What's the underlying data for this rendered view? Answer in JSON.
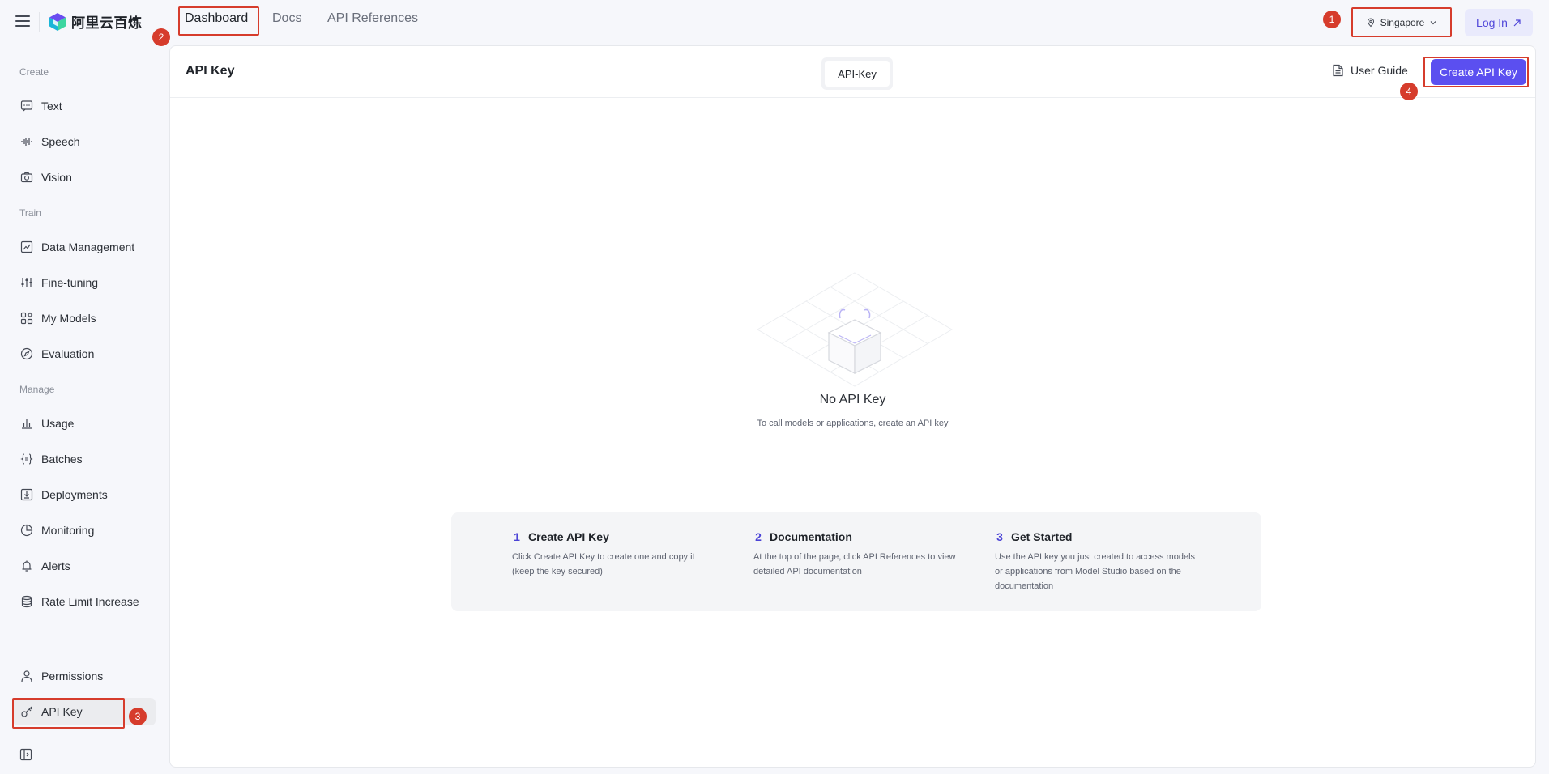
{
  "header": {
    "logo_text": "阿里云百炼",
    "tabs": [
      {
        "label": "Dashboard"
      },
      {
        "label": "Docs"
      },
      {
        "label": "API References"
      }
    ],
    "region": "Singapore",
    "login_label": "Log In"
  },
  "annotations": {
    "badge_1": "1",
    "badge_2": "2",
    "badge_3": "3",
    "badge_4": "4"
  },
  "sidebar": {
    "sections": {
      "create": "Create",
      "train": "Train",
      "manage": "Manage"
    },
    "items": [
      {
        "label": "Text",
        "icon": "chat-icon"
      },
      {
        "label": "Speech",
        "icon": "waveform-icon"
      },
      {
        "label": "Vision",
        "icon": "camera-icon"
      },
      {
        "label": "Data Management",
        "icon": "chart-icon"
      },
      {
        "label": "Fine-tuning",
        "icon": "sliders-icon"
      },
      {
        "label": "My Models",
        "icon": "grid-icon"
      },
      {
        "label": "Evaluation",
        "icon": "compass-icon"
      },
      {
        "label": "Usage",
        "icon": "bar-chart-icon"
      },
      {
        "label": "Batches",
        "icon": "braces-icon"
      },
      {
        "label": "Deployments",
        "icon": "download-box-icon"
      },
      {
        "label": "Monitoring",
        "icon": "pie-icon"
      },
      {
        "label": "Alerts",
        "icon": "bell-icon"
      },
      {
        "label": "Rate Limit Increase",
        "icon": "database-icon"
      },
      {
        "label": "Permissions",
        "icon": "user-icon"
      },
      {
        "label": "API Key",
        "icon": "key-icon"
      }
    ]
  },
  "main": {
    "title": "API Key",
    "segment_label": "API-Key",
    "user_guide_label": "User Guide",
    "create_button_label": "Create API Key",
    "empty": {
      "title": "No API Key",
      "description": "To call models or applications, create an API key"
    },
    "steps": [
      {
        "num": "1",
        "title": "Create API Key",
        "desc": "Click Create API Key to create one and copy it (keep the key secured)"
      },
      {
        "num": "2",
        "title": "Documentation",
        "desc": "At the top of the page, click API References to view detailed API documentation"
      },
      {
        "num": "3",
        "title": "Get Started",
        "desc": "Use the API key you just created to access models or applications from Model Studio based on the documentation"
      }
    ]
  },
  "colors": {
    "accent": "#5b4ff0",
    "highlight": "#d63c2c"
  }
}
